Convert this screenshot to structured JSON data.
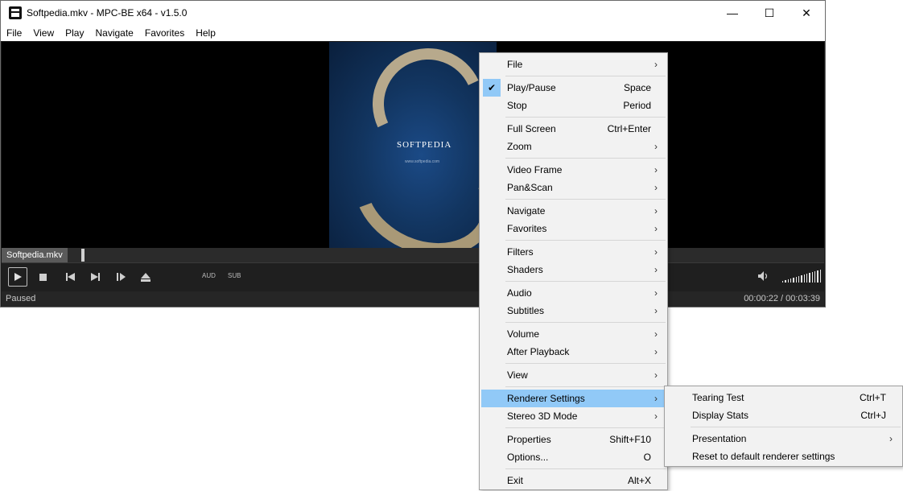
{
  "window": {
    "title": "Softpedia.mkv - MPC-BE x64 - v1.5.0",
    "minimize": "—",
    "maximize": "☐",
    "close": "✕"
  },
  "menubar": [
    "File",
    "View",
    "Play",
    "Navigate",
    "Favorites",
    "Help"
  ],
  "video": {
    "watermark": "SOFTPEDIA",
    "watermark_url": "www.softpedia.com"
  },
  "infobar": {
    "filename": "Softpedia.mkv"
  },
  "controls": {
    "aud_label": "AUD",
    "sub_label": "SUB",
    "volume_level": 1.0
  },
  "status": {
    "state": "Paused",
    "time": "00:00:22 / 00:03:39"
  },
  "context_menu": {
    "items": [
      {
        "label": "File",
        "shortcut": "",
        "submenu": true
      },
      {
        "label": "Play/Pause",
        "shortcut": "Space",
        "checked": true
      },
      {
        "label": "Stop",
        "shortcut": "Period"
      },
      {
        "label": "Full Screen",
        "shortcut": "Ctrl+Enter"
      },
      {
        "label": "Zoom",
        "shortcut": "",
        "submenu": true
      },
      {
        "label": "Video Frame",
        "shortcut": "",
        "submenu": true
      },
      {
        "label": "Pan&Scan",
        "shortcut": "",
        "submenu": true
      },
      {
        "label": "Navigate",
        "shortcut": "",
        "submenu": true
      },
      {
        "label": "Favorites",
        "shortcut": "",
        "submenu": true
      },
      {
        "label": "Filters",
        "shortcut": "",
        "submenu": true
      },
      {
        "label": "Shaders",
        "shortcut": "",
        "submenu": true
      },
      {
        "label": "Audio",
        "shortcut": "",
        "submenu": true
      },
      {
        "label": "Subtitles",
        "shortcut": "",
        "submenu": true
      },
      {
        "label": "Volume",
        "shortcut": "",
        "submenu": true
      },
      {
        "label": "After Playback",
        "shortcut": "",
        "submenu": true
      },
      {
        "label": "View",
        "shortcut": "",
        "submenu": true
      },
      {
        "label": "Renderer Settings",
        "shortcut": "",
        "submenu": true,
        "highlighted": true
      },
      {
        "label": "Stereo 3D Mode",
        "shortcut": "",
        "submenu": true
      },
      {
        "label": "Properties",
        "shortcut": "Shift+F10"
      },
      {
        "label": "Options...",
        "shortcut": "O"
      },
      {
        "label": "Exit",
        "shortcut": "Alt+X"
      }
    ]
  },
  "renderer_submenu": {
    "items": [
      {
        "label": "Tearing Test",
        "shortcut": "Ctrl+T"
      },
      {
        "label": "Display Stats",
        "shortcut": "Ctrl+J"
      },
      {
        "label": "Presentation",
        "shortcut": "",
        "submenu": true
      },
      {
        "label": "Reset to default renderer settings",
        "shortcut": ""
      }
    ]
  },
  "colors": {
    "menu_highlight": "#91c9f7",
    "menu_bg": "#f2f2f2",
    "player_bg": "#1b1b1b"
  }
}
